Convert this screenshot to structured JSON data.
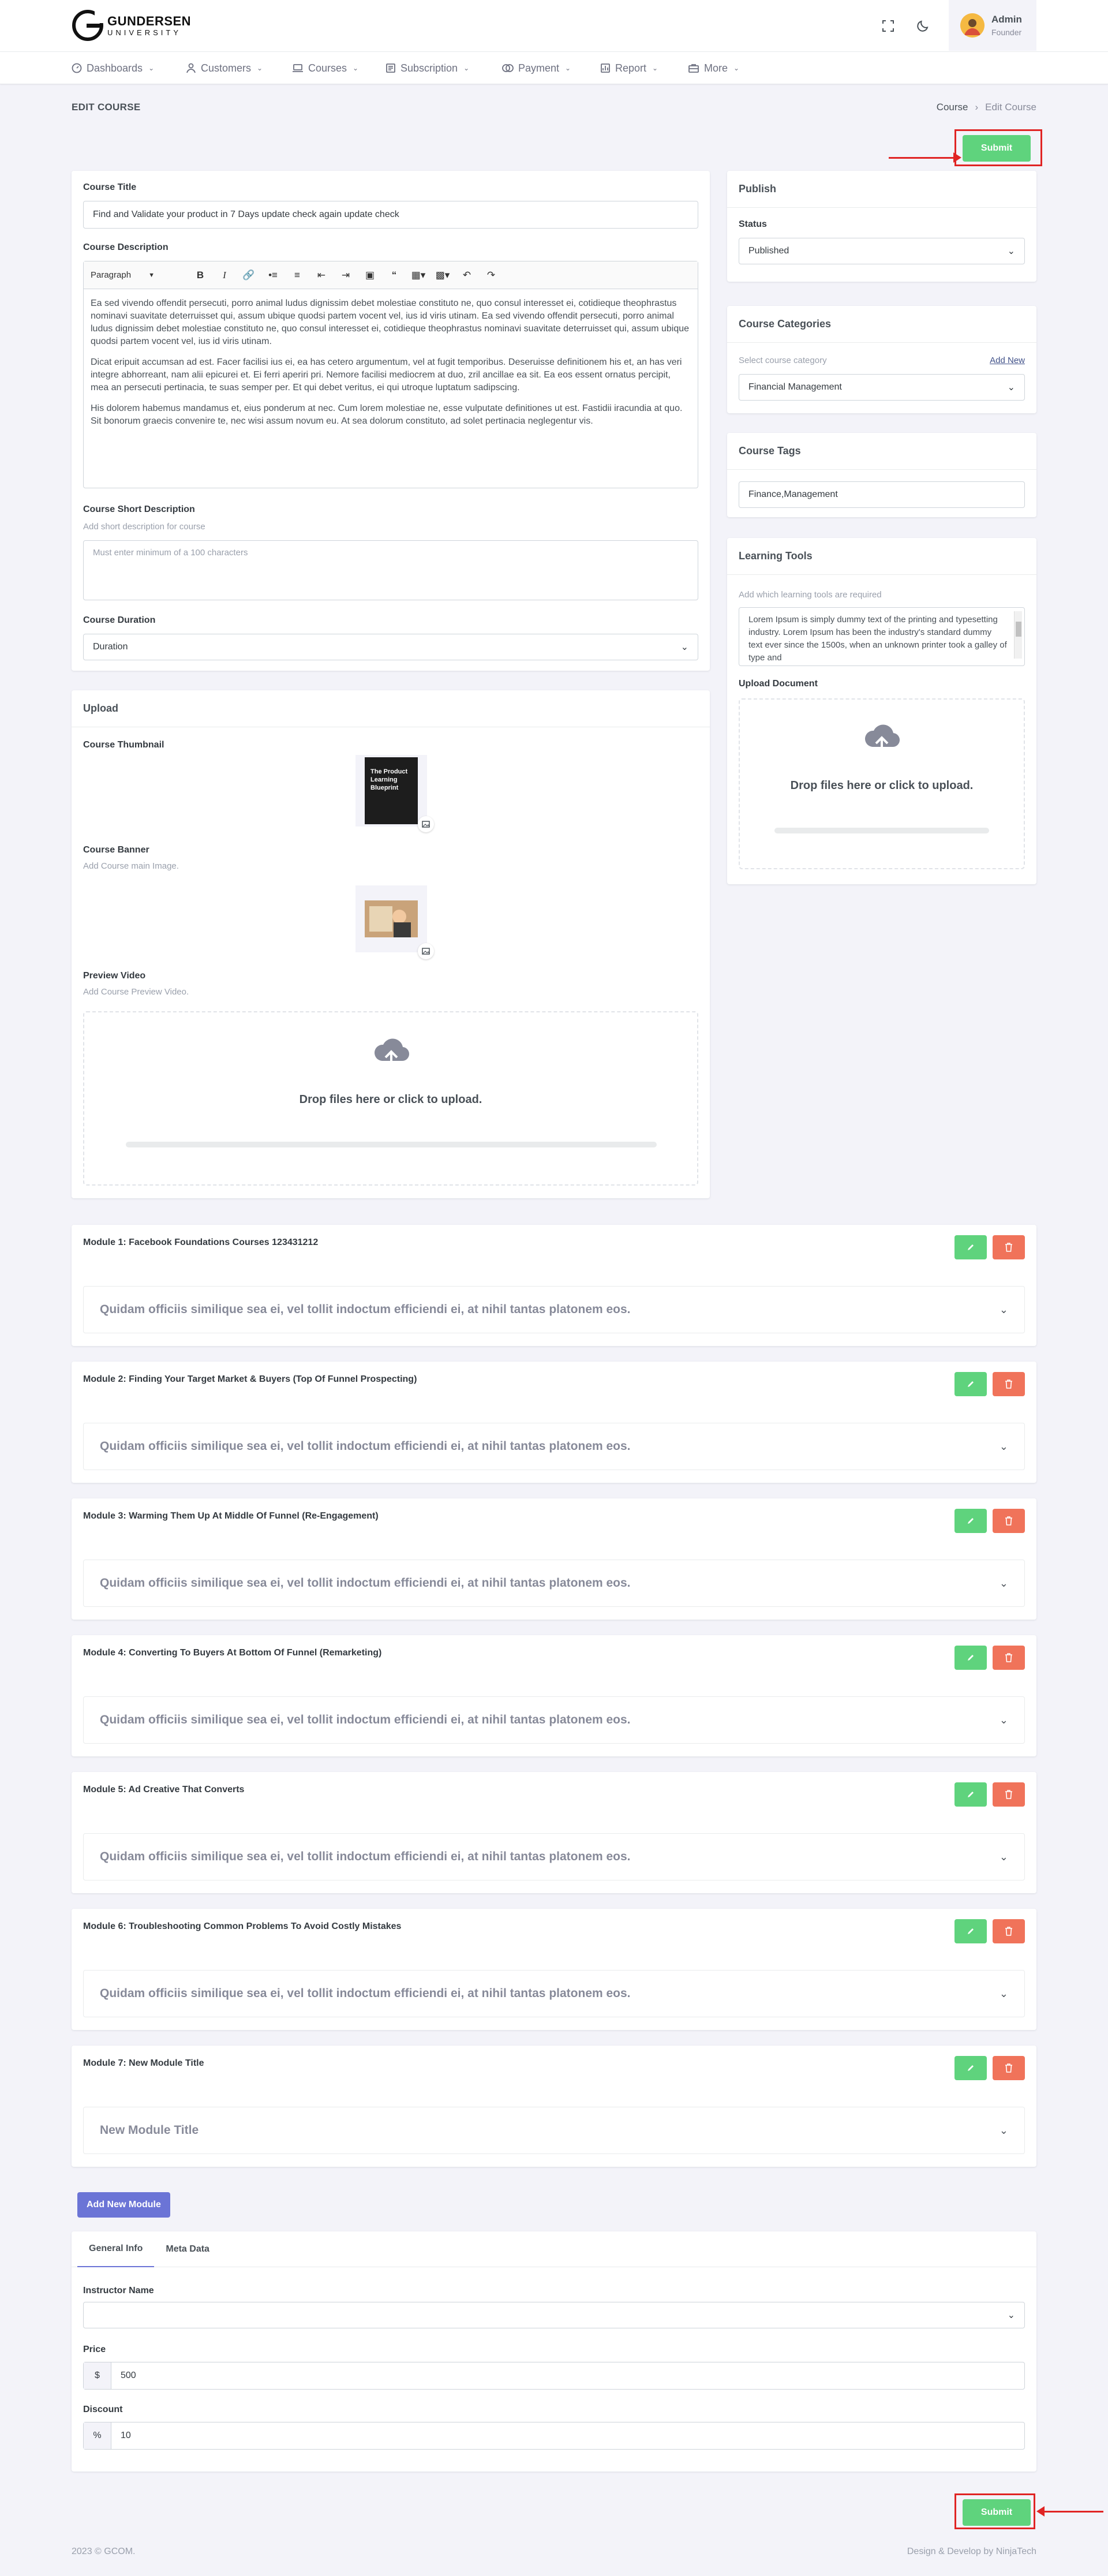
{
  "brand": {
    "name": "GUNDERSEN",
    "sub": "UNIVERSITY"
  },
  "user": {
    "name": "Admin",
    "role": "Founder"
  },
  "nav": [
    {
      "label": "Dashboards",
      "icon": "dashboard-icon"
    },
    {
      "label": "Customers",
      "icon": "user-icon"
    },
    {
      "label": "Courses",
      "icon": "laptop-icon"
    },
    {
      "label": "Subscription",
      "icon": "subscription-icon"
    },
    {
      "label": "Payment",
      "icon": "payment-icon"
    },
    {
      "label": "Report",
      "icon": "report-icon"
    },
    {
      "label": "More",
      "icon": "briefcase-icon"
    }
  ],
  "page": {
    "title": "EDIT COURSE",
    "breadcrumb": [
      "Course",
      "Edit Course"
    ]
  },
  "submit_label": "Submit",
  "course": {
    "title_label": "Course Title",
    "title_value": "Find and Validate your product in 7 Days update check again update check",
    "description_label": "Course Description",
    "toolbar_paragraph": "Paragraph",
    "description_paragraphs": [
      "Ea sed vivendo offendit persecuti, porro animal ludus dignissim debet molestiae constituto ne, quo consul interesset ei, cotidieque theophrastus nominavi suavitate deterruisset qui, assum ubique quodsi partem vocent vel, ius id viris utinam. Ea sed vivendo offendit persecuti, porro animal ludus dignissim debet molestiae constituto ne, quo consul interesset ei, cotidieque theophrastus nominavi suavitate deterruisset qui, assum ubique quodsi partem vocent vel, ius id viris utinam.",
      "Dicat eripuit accumsan ad est. Facer facilisi ius ei, ea has cetero argumentum, vel at fugit temporibus. Deseruisse definitionem his et, an has veri integre abhorreant, nam alii epicurei et. Ei ferri aperiri pri. Nemore facilisi mediocrem at duo, zril ancillae ea sit. Ea eos essent ornatus percipit, mea an persecuti pertinacia, te suas semper per. Et qui debet veritus, ei qui utroque luptatum sadipscing.",
      "His dolorem habemus mandamus et, eius ponderum at nec. Cum lorem molestiae ne, esse vulputate definitiones ut est. Fastidii iracundia at quo. Sit bonorum graecis convenire te, nec wisi assum novum eu. At sea dolorum constituto, ad solet pertinacia neglegentur vis."
    ],
    "short_label": "Course Short Description",
    "short_hint": "Add short description for course",
    "short_placeholder": "Must enter minimum of a 100 characters",
    "duration_label": "Course Duration",
    "duration_value": "Duration"
  },
  "upload": {
    "title": "Upload",
    "thumbnail_label": "Course Thumbnail",
    "thumbnail_text": "The Product Learning Blueprint",
    "banner_label": "Course Banner",
    "banner_hint": "Add Course main Image.",
    "video_label": "Preview Video",
    "video_hint": "Add Course Preview Video.",
    "drop_text": "Drop files here or click to upload."
  },
  "publish": {
    "title": "Publish",
    "status_label": "Status",
    "status_value": "Published"
  },
  "categories": {
    "title": "Course Categories",
    "hint": "Select course category",
    "add_new": "Add New",
    "value": "Financial Management"
  },
  "tags": {
    "title": "Course Tags",
    "value": "Finance,Management"
  },
  "tools": {
    "title": "Learning Tools",
    "hint": "Add which learning tools are required",
    "text": "Lorem Ipsum is simply dummy text of the printing and typesetting industry. Lorem Ipsum has been the industry's standard dummy text ever since the 1500s, when an unknown printer took a galley of type and",
    "upload_label": "Upload Document",
    "drop_text": "Drop files here or click to upload."
  },
  "modules": [
    {
      "title": "Module 1: Facebook Foundations Courses 123431212",
      "lesson": "Quidam officiis similique sea ei, vel tollit indoctum efficiendi ei, at nihil tantas platonem eos."
    },
    {
      "title": "Module 2: Finding Your Target Market & Buyers (Top Of Funnel Prospecting)",
      "lesson": "Quidam officiis similique sea ei, vel tollit indoctum efficiendi ei, at nihil tantas platonem eos."
    },
    {
      "title": "Module 3: Warming Them Up At Middle Of Funnel (Re-Engagement)",
      "lesson": "Quidam officiis similique sea ei, vel tollit indoctum efficiendi ei, at nihil tantas platonem eos."
    },
    {
      "title": "Module 4: Converting To Buyers At Bottom Of Funnel (Remarketing)",
      "lesson": "Quidam officiis similique sea ei, vel tollit indoctum efficiendi ei, at nihil tantas platonem eos."
    },
    {
      "title": "Module 5: Ad Creative That Converts",
      "lesson": "Quidam officiis similique sea ei, vel tollit indoctum efficiendi ei, at nihil tantas platonem eos."
    },
    {
      "title": "Module 6: Troubleshooting Common Problems To Avoid Costly Mistakes",
      "lesson": "Quidam officiis similique sea ei, vel tollit indoctum efficiendi ei, at nihil tantas platonem eos."
    },
    {
      "title": "Module 7: New Module Title",
      "lesson": "New Module Title"
    }
  ],
  "add_module_label": "Add New Module",
  "info": {
    "tabs": [
      "General Info",
      "Meta Data"
    ],
    "instructor_label": "Instructor Name",
    "instructor_value": "",
    "price_label": "Price",
    "price_prefix": "$",
    "price_value": "500",
    "discount_label": "Discount",
    "discount_prefix": "%",
    "discount_value": "10"
  },
  "footer": {
    "left": "2023 © GCOM.",
    "right": "Design & Develop by NinjaTech"
  },
  "colors": {
    "accent": "#6b74d6",
    "success": "#5fd37d",
    "danger": "#f0735a",
    "annotation": "#e02424"
  }
}
